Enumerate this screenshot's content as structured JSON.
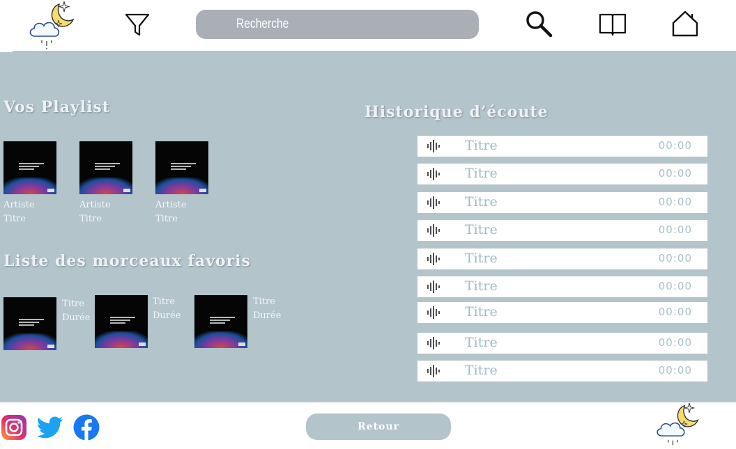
{
  "header": {
    "search_placeholder": "Recherche"
  },
  "playlists": {
    "title": "Vos Playlist",
    "items": [
      {
        "artist": "Artiste",
        "title": "Titre"
      },
      {
        "artist": "Artiste",
        "title": "Titre"
      },
      {
        "artist": "Artiste",
        "title": "Titre"
      }
    ]
  },
  "favorites": {
    "title": "Liste des morceaux favoris",
    "items": [
      {
        "title": "Titre",
        "duration": "Durée"
      },
      {
        "title": "Titre",
        "duration": "Durée"
      },
      {
        "title": "Titre",
        "duration": "Durée"
      }
    ]
  },
  "history": {
    "title": "Historique d’écoute",
    "rows": [
      {
        "title": "Titre",
        "time": "00:00"
      },
      {
        "title": "Titre",
        "time": "00:00"
      },
      {
        "title": "Titre",
        "time": "00:00"
      },
      {
        "title": "Titre",
        "time": "00:00"
      },
      {
        "title": "Titre",
        "time": "00:00"
      },
      {
        "title": "Titre",
        "time": "00:00"
      },
      {
        "title": "Titre",
        "time": "00:00"
      },
      {
        "title": "Titre",
        "time": "00:00"
      },
      {
        "title": "Titre",
        "time": "00:00"
      }
    ]
  },
  "footer": {
    "back_label": "Retour",
    "social": [
      "instagram-icon",
      "twitter-icon",
      "facebook-icon"
    ]
  },
  "icons": {
    "logo": "moon-cloud-logo",
    "filter": "filter-icon",
    "search": "search-icon",
    "book": "book-icon",
    "home": "home-icon",
    "wave": "soundwave-icon"
  },
  "colors": {
    "panel": "#b3c4cb",
    "search_bar": "#a9afb4",
    "row_text": "#9fbcc6",
    "moon": "#f3dc6a",
    "instagram": "#d6286e",
    "twitter": "#1da1f2",
    "facebook": "#1877f2"
  }
}
